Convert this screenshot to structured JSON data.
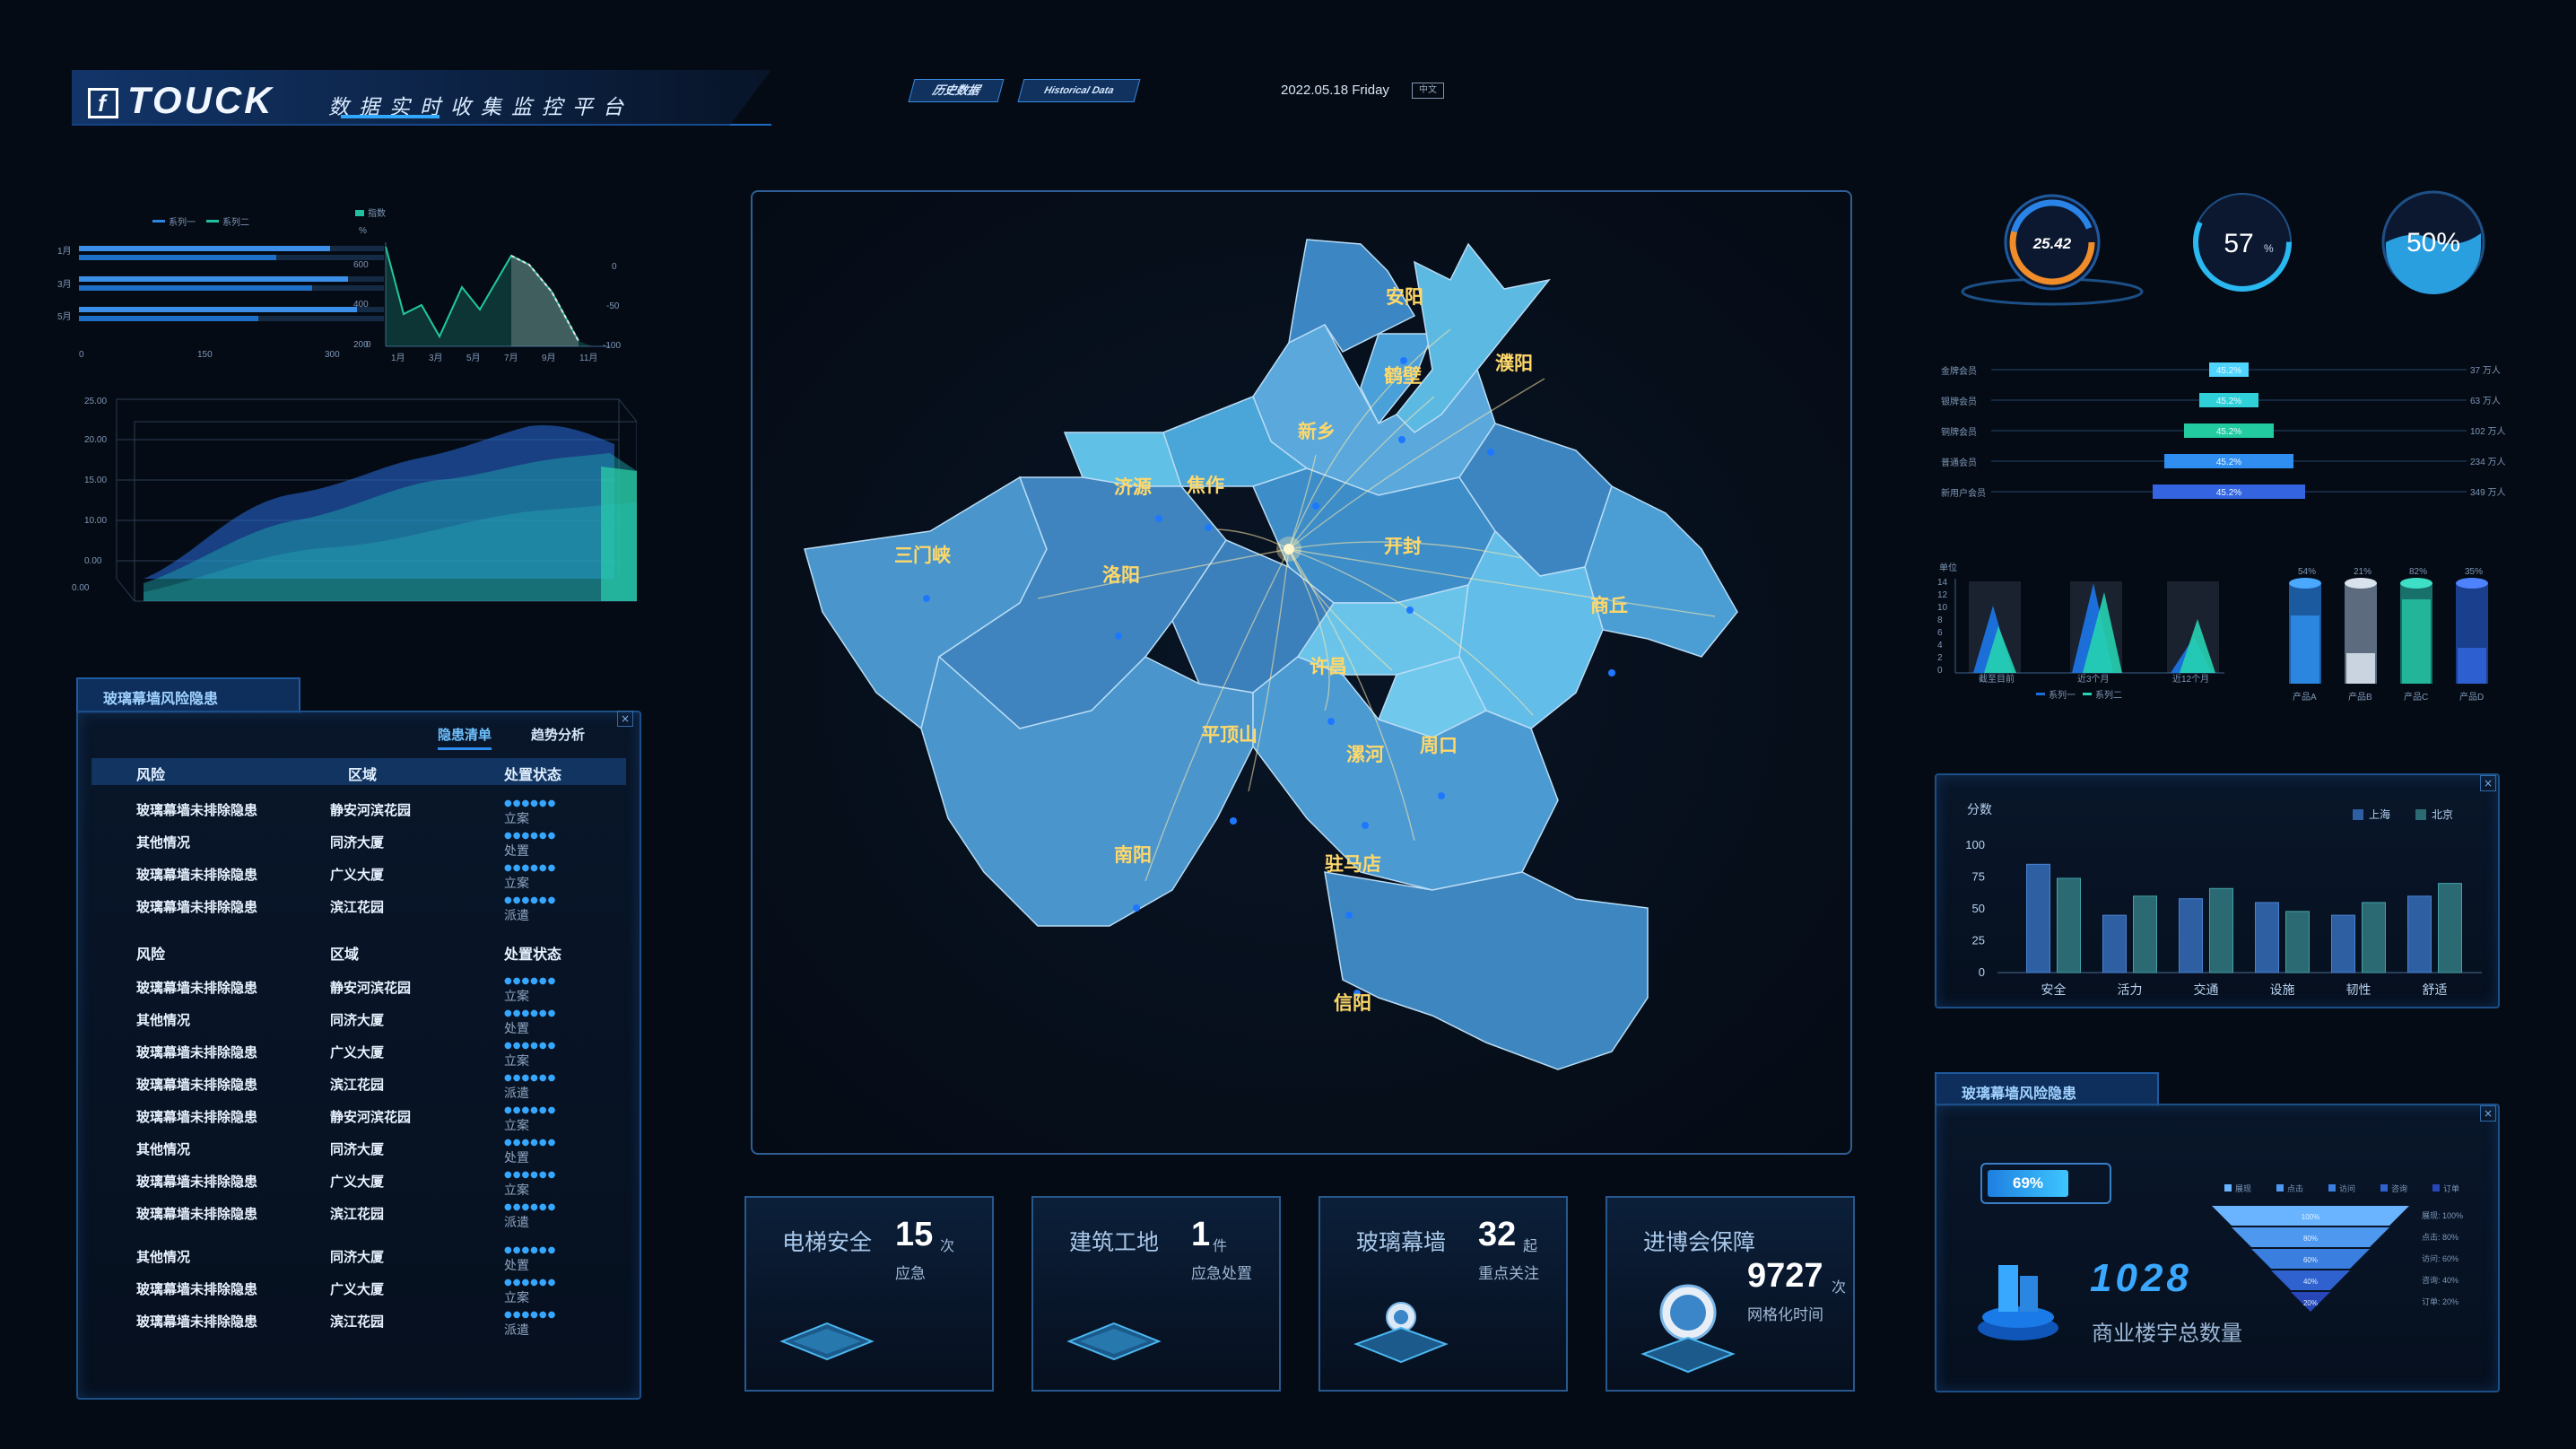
{
  "header": {
    "logo_text": "TOUCK",
    "logo_letter": "f",
    "subtitle": "数据实时收集监控平台",
    "tag_history_cn": "历史数据",
    "tag_history_en": "Historical Data",
    "date": "2022.05.18  Friday",
    "lang": "中文"
  },
  "left_top_chart": {
    "legend": [
      "系列一",
      "系列二"
    ],
    "rows": [
      "1月",
      "3月",
      "5月"
    ],
    "x_ticks": [
      "0",
      "150",
      "300"
    ],
    "line_legend": "指数",
    "line_y_left": [
      "%",
      "600",
      "400",
      "200",
      "0"
    ],
    "line_y_right": [
      "0",
      "-50",
      "-100"
    ],
    "line_x": [
      "1月",
      "3月",
      "5月",
      "7月",
      "9月",
      "11月"
    ]
  },
  "area3d": {
    "y_ticks": [
      "25.00",
      "20.00",
      "15.00",
      "10.00",
      "0.00",
      "0.00"
    ]
  },
  "risk_list": {
    "tab_title": "玻璃幕墙风险隐患",
    "sub_tabs": [
      "隐患清单",
      "趋势分析"
    ],
    "headers": [
      "风险",
      "区域",
      "处置状态"
    ],
    "group1": [
      {
        "risk": "玻璃幕墙未排除隐患",
        "area": "静安河滨花园",
        "status": "立案"
      },
      {
        "risk": "其他情况",
        "area": "同济大厦",
        "status": "处置"
      },
      {
        "risk": "玻璃幕墙未排除隐患",
        "area": "广义大厦",
        "status": "立案"
      },
      {
        "risk": "玻璃幕墙未排除隐患",
        "area": "滨江花园",
        "status": "派遣"
      }
    ],
    "group2": [
      {
        "risk": "玻璃幕墙未排除隐患",
        "area": "静安河滨花园",
        "status": "立案"
      },
      {
        "risk": "其他情况",
        "area": "同济大厦",
        "status": "处置"
      },
      {
        "risk": "玻璃幕墙未排除隐患",
        "area": "广义大厦",
        "status": "立案"
      },
      {
        "risk": "玻璃幕墙未排除隐患",
        "area": "滨江花园",
        "status": "派遣"
      },
      {
        "risk": "玻璃幕墙未排除隐患",
        "area": "静安河滨花园",
        "status": "立案"
      },
      {
        "risk": "其他情况",
        "area": "同济大厦",
        "status": "处置"
      },
      {
        "risk": "玻璃幕墙未排除隐患",
        "area": "广义大厦",
        "status": "立案"
      },
      {
        "risk": "玻璃幕墙未排除隐患",
        "area": "滨江花园",
        "status": "派遣"
      }
    ],
    "group3": [
      {
        "risk": "其他情况",
        "area": "同济大厦",
        "status": "处置"
      },
      {
        "risk": "玻璃幕墙未排除隐患",
        "area": "广义大厦",
        "status": "立案"
      },
      {
        "risk": "玻璃幕墙未排除隐患",
        "area": "滨江花园",
        "status": "派遣"
      }
    ]
  },
  "map": {
    "cities": [
      "安阳",
      "鹤壁",
      "濮阳",
      "新乡",
      "济源",
      "焦作",
      "三门峡",
      "洛阳",
      "开封",
      "商丘",
      "许昌",
      "平顶山",
      "周口",
      "漯河",
      "南阳",
      "驻马店",
      "信阳"
    ]
  },
  "stats": [
    {
      "name": "电梯安全",
      "value": "15",
      "unit": "次",
      "desc": "应急"
    },
    {
      "name": "建筑工地",
      "value": "1",
      "unit": "件",
      "desc": "应急处置"
    },
    {
      "name": "玻璃幕墙",
      "value": "32",
      "unit": "起",
      "desc": "重点关注"
    },
    {
      "name": "进博会保障",
      "value": "9727",
      "unit": "次",
      "desc": "网格化时间"
    }
  ],
  "gauges": [
    {
      "value": "25.42"
    },
    {
      "value": "57",
      "unit": "%"
    },
    {
      "value": "50%"
    }
  ],
  "center_bars": {
    "rows": [
      {
        "label": "金牌会员",
        "value": "45.2%",
        "right": "37"
      },
      {
        "label": "银牌会员",
        "value": "45.2%",
        "right": "63"
      },
      {
        "label": "铜牌会员",
        "value": "45.2%",
        "right": "102"
      },
      {
        "label": "普通会员",
        "value": "45.2%",
        "right": "234"
      },
      {
        "label": "新用户会员",
        "value": "45.2%",
        "right": "349"
      }
    ],
    "unit": "万人"
  },
  "triangle_chart": {
    "y_label": "单位",
    "y_ticks": [
      "14",
      "12",
      "10",
      "8",
      "6",
      "4",
      "2",
      "0"
    ],
    "x": [
      "截至目前",
      "近3个月",
      "近12个月"
    ],
    "legend": [
      "系列一",
      "系列二"
    ]
  },
  "cylinders": {
    "values": [
      "54%",
      "21%",
      "82%",
      "35%"
    ],
    "names": [
      "产品A",
      "产品B",
      "产品C",
      "产品D"
    ]
  },
  "chart_data": {
    "type": "bar",
    "ylabel": "分数",
    "categories": [
      "安全",
      "活力",
      "交通",
      "设施",
      "韧性",
      "舒适"
    ],
    "ylim": [
      0,
      100
    ],
    "y_ticks": [
      "100",
      "75",
      "50",
      "25",
      "0"
    ],
    "series": [
      {
        "name": "上海",
        "values": [
          85,
          45,
          58,
          55,
          45,
          60
        ],
        "color": "#2e5fa3"
      },
      {
        "name": "北京",
        "values": [
          74,
          60,
          66,
          48,
          55,
          70
        ],
        "color": "#2b6a72"
      }
    ],
    "legend_position": "top-right"
  },
  "funnel": {
    "tab_title": "玻璃幕墙风险隐患",
    "percent": "69%",
    "big_number": "1028",
    "caption": "商业楼宇总数量",
    "legend": [
      "展现",
      "点击",
      "访问",
      "咨询",
      "订单"
    ],
    "layers": [
      "100%",
      "80%",
      "60%",
      "40%",
      "20%"
    ],
    "right_labels": [
      "展现: 100%",
      "点击: 80%",
      "访问: 60%",
      "咨询: 40%",
      "订单: 20%"
    ]
  }
}
